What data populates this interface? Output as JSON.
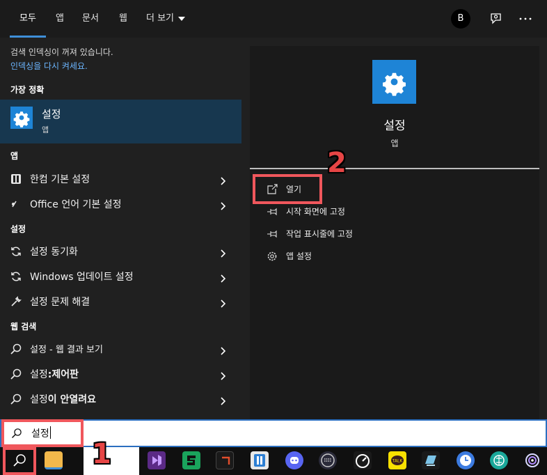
{
  "tabs": [
    {
      "label": "모두",
      "active": true
    },
    {
      "label": "앱"
    },
    {
      "label": "문서"
    },
    {
      "label": "웹"
    },
    {
      "label": "더 보기"
    }
  ],
  "user": {
    "avatar_letter": "B"
  },
  "left": {
    "notice_line1": "검색 인덱싱이 꺼져 있습니다.",
    "notice_link": "인덱싱을 다시 켜세요.",
    "best_match_header": "가장 정확",
    "best_match": {
      "title": "설정",
      "subtitle": "앱"
    },
    "apps_header": "앱",
    "apps": [
      {
        "label": "한컴 기본 설정",
        "icon": "hancom-icon"
      },
      {
        "label": "Office 언어 기본 설정",
        "icon": "office-lang-icon"
      }
    ],
    "settings_header": "설정",
    "settings": [
      {
        "label": "설정 동기화",
        "icon": "sync-icon"
      },
      {
        "label": "Windows 업데이트 설정",
        "icon": "update-icon"
      },
      {
        "label": "설정 문제 해결",
        "icon": "wrench-icon"
      }
    ],
    "web_header": "웹 검색",
    "web": [
      {
        "label_bold": "설정",
        "label_rest": " - 웹 결과 보기"
      },
      {
        "label_bold": "설정",
        "label_rest": ":제어판"
      },
      {
        "label_bold": "설정",
        "label_rest": "이 안열려요"
      }
    ]
  },
  "preview": {
    "title": "설정",
    "subtitle": "앱",
    "actions": [
      {
        "label": "열기",
        "icon": "open-icon"
      },
      {
        "label": "시작 화면에 고정",
        "icon": "pin-icon"
      },
      {
        "label": "작업 표시줄에 고정",
        "icon": "pin-icon"
      },
      {
        "label": "앱 설정",
        "icon": "gear-icon"
      }
    ]
  },
  "search": {
    "query": "설정"
  },
  "annotations": {
    "step1": "1",
    "step2": "2"
  },
  "colors": {
    "accent": "#1e84d6",
    "highlight": "#f0575c",
    "selected": "#17374f"
  }
}
